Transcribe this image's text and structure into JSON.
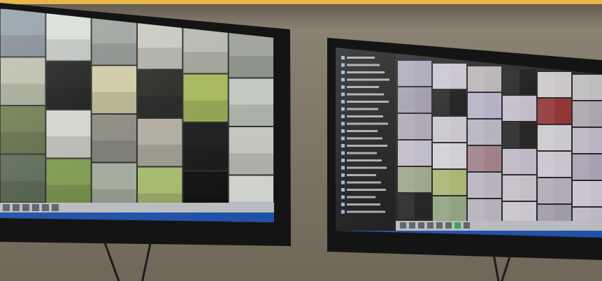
{
  "scene": {
    "title": "",
    "colors": {
      "wall": "#7f7767",
      "top_strip": "#e8b54a",
      "bezel": "#141414",
      "taskbar": "#1f4fa8",
      "sidebar": "#1b1b1b"
    }
  },
  "left_monitor": {
    "label": "",
    "grid": {
      "columns": 6,
      "rows": 4
    },
    "feeds": [
      {
        "c": "#8e9aa3"
      },
      {
        "c": "#d8dcd6"
      },
      {
        "c": "#9aa19b"
      },
      {
        "c": "#c9c8bd"
      },
      {
        "c": "#b7b9ae"
      },
      {
        "c": "#9ea39b"
      },
      {
        "c": "#b9bda8"
      },
      {
        "c": "#1a1a1a"
      },
      {
        "c": "#cfcaa2"
      },
      {
        "c": "#2a2a27"
      },
      {
        "c": "#a6b85c"
      },
      {
        "c": "#c1c7be"
      },
      {
        "c": "#6b7a4d"
      },
      {
        "c": "#d2d3c9"
      },
      {
        "c": "#8b8a80"
      },
      {
        "c": "#b0aca0"
      },
      {
        "c": "#1c1c1c"
      },
      {
        "c": "#c4c5bd"
      },
      {
        "c": "#5a6a54"
      },
      {
        "c": "#7d9a4f"
      },
      {
        "c": "#a3a99a"
      },
      {
        "c": "#a4b86e"
      },
      {
        "c": "#111111"
      },
      {
        "c": "#cfd2cc"
      }
    ],
    "toolbar_buttons": 6
  },
  "right_monitor": {
    "label": "",
    "sidebar_rows": 22,
    "grid": {
      "columns": 6,
      "rows": 6
    },
    "feeds": [
      {
        "c": "#a7a4b7"
      },
      {
        "c": "#c7c2cf"
      },
      {
        "c": "#b6b1b2"
      },
      {
        "c": "#1a1a1a"
      },
      {
        "c": "#c9c5c8"
      },
      {
        "c": "#bdbabd"
      },
      {
        "c": "#9c96a8"
      },
      {
        "c": "#161616"
      },
      {
        "c": "#b2adc4"
      },
      {
        "c": "#c0bac6"
      },
      {
        "c": "#8e2f2f"
      },
      {
        "c": "#a8a3a9"
      },
      {
        "c": "#a9a3b1"
      },
      {
        "c": "#c7c3ca"
      },
      {
        "c": "#b4b0bd"
      },
      {
        "c": "#202020"
      },
      {
        "c": "#cac7ce"
      },
      {
        "c": "#b8b2c0"
      },
      {
        "c": "#bdb8c6"
      },
      {
        "c": "#d1cdd5"
      },
      {
        "c": "#9d7c86"
      },
      {
        "c": "#bcb6c3"
      },
      {
        "c": "#c8c3cd"
      },
      {
        "c": "#a79fb0"
      },
      {
        "c": "#9aa286"
      },
      {
        "c": "#a6b36f"
      },
      {
        "c": "#b7b1bd"
      },
      {
        "c": "#c3bdc6"
      },
      {
        "c": "#b0a9b6"
      },
      {
        "c": "#c6c0cb"
      },
      {
        "c": "#1e1e1e"
      },
      {
        "c": "#8da07c"
      },
      {
        "c": "#b3aebb"
      },
      {
        "c": "#c9c4cd"
      },
      {
        "c": "#9f99a6"
      },
      {
        "c": "#bcb7c2"
      }
    ],
    "toolbar_buttons": 8
  }
}
